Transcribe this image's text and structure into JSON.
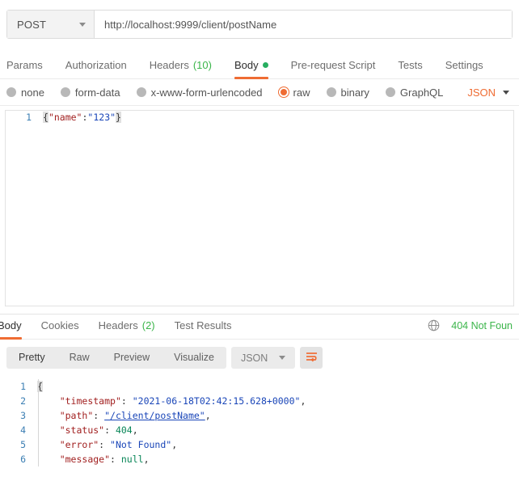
{
  "request": {
    "method": "POST",
    "url": "http://localhost:9999/client/postName",
    "tabs": [
      {
        "label": "Params",
        "count": "",
        "active": false
      },
      {
        "label": "Authorization",
        "count": "",
        "active": false
      },
      {
        "label": "Headers",
        "count": "(10)",
        "active": false
      },
      {
        "label": "Body",
        "count": "",
        "active": true
      },
      {
        "label": "Pre-request Script",
        "count": "",
        "active": false
      },
      {
        "label": "Tests",
        "count": "",
        "active": false
      },
      {
        "label": "Settings",
        "count": "",
        "active": false
      }
    ],
    "body_types": [
      {
        "label": "none",
        "selected": false
      },
      {
        "label": "form-data",
        "selected": false
      },
      {
        "label": "x-www-form-urlencoded",
        "selected": false
      },
      {
        "label": "raw",
        "selected": true
      },
      {
        "label": "binary",
        "selected": false
      },
      {
        "label": "GraphQL",
        "selected": false
      }
    ],
    "raw_format": "JSON",
    "editor": {
      "line_number": "1",
      "open_brace": "{",
      "key": "\"name\"",
      "colon": ":",
      "value": "\"123\"",
      "close_brace": "}"
    }
  },
  "response": {
    "tabs": [
      {
        "label": "Body",
        "count": "",
        "active": true
      },
      {
        "label": "Cookies",
        "count": "",
        "active": false
      },
      {
        "label": "Headers",
        "count": "(2)",
        "active": false
      },
      {
        "label": "Test Results",
        "count": "",
        "active": false
      }
    ],
    "status": "404 Not Foun",
    "globe_icon": "globe-icon",
    "view_modes": [
      {
        "label": "Pretty",
        "active": true
      },
      {
        "label": "Raw",
        "active": false
      },
      {
        "label": "Preview",
        "active": false
      },
      {
        "label": "Visualize",
        "active": false
      }
    ],
    "format": "JSON",
    "wrap_icon": "word-wrap-icon",
    "body_lines": [
      {
        "n": "1",
        "indent": "",
        "key": "",
        "colon": "",
        "value": "{",
        "type": "brace",
        "comma": ""
      },
      {
        "n": "2",
        "indent": "    ",
        "key": "\"timestamp\"",
        "colon": ": ",
        "value": "\"2021-06-18T02:42:15.628+0000\"",
        "type": "string",
        "comma": ","
      },
      {
        "n": "3",
        "indent": "    ",
        "key": "\"path\"",
        "colon": ": ",
        "value": "\"/client/postName\"",
        "type": "link",
        "comma": ","
      },
      {
        "n": "4",
        "indent": "    ",
        "key": "\"status\"",
        "colon": ": ",
        "value": "404",
        "type": "number",
        "comma": ","
      },
      {
        "n": "5",
        "indent": "    ",
        "key": "\"error\"",
        "colon": ": ",
        "value": "\"Not Found\"",
        "type": "string",
        "comma": ","
      },
      {
        "n": "6",
        "indent": "    ",
        "key": "\"message\"",
        "colon": ": ",
        "value": "null",
        "type": "number",
        "comma": ","
      }
    ]
  },
  "colors": {
    "accent": "#ef6c33",
    "success": "#3bb54a",
    "text": "#4a4a4a"
  }
}
